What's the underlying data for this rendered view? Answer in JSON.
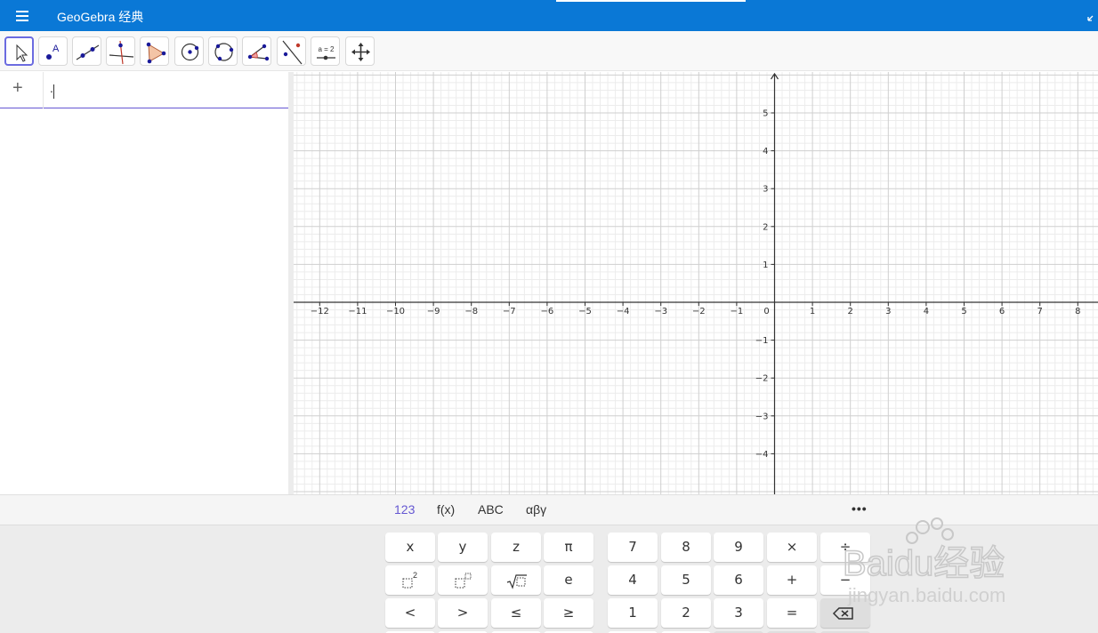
{
  "window": {
    "title": "GeoGebra 经典",
    "accent_color": "#0a78d6",
    "menu_icon": "hamburger-menu-icon",
    "restore_icon": "restore-icon"
  },
  "toolbar": {
    "tools": [
      {
        "name": "move",
        "icon": "arrow-cursor-icon",
        "selected": true
      },
      {
        "name": "point",
        "icon": "point-icon"
      },
      {
        "name": "line",
        "icon": "line-icon"
      },
      {
        "name": "perpendicular-line",
        "icon": "perpendicular-line-icon"
      },
      {
        "name": "polygon",
        "icon": "polygon-icon"
      },
      {
        "name": "circle-center-point",
        "icon": "circle-center-icon"
      },
      {
        "name": "circle-three-points",
        "icon": "circle-three-points-icon"
      },
      {
        "name": "angle",
        "icon": "angle-icon"
      },
      {
        "name": "reflect",
        "icon": "reflect-icon"
      },
      {
        "name": "slider",
        "icon": "slider-icon",
        "label": "a = 2"
      },
      {
        "name": "move-graphics-view",
        "icon": "move-view-icon"
      }
    ]
  },
  "algebra": {
    "add_label": "+",
    "input_value": ".",
    "input_placeholder": ""
  },
  "graphics": {
    "x_range": [
      -12,
      8
    ],
    "y_range": [
      -4,
      5
    ],
    "x_ticks": [
      "−12",
      "−11",
      "−10",
      "−9",
      "−8",
      "−7",
      "−6",
      "−5",
      "−4",
      "−3",
      "−2",
      "−1",
      "0",
      "1",
      "2",
      "3",
      "4",
      "5",
      "6",
      "7",
      "8"
    ],
    "y_ticks": [
      "5",
      "4",
      "3",
      "2",
      "1",
      "−1",
      "−2",
      "−3",
      "−4"
    ],
    "grid": true,
    "axis_color": "#333333",
    "grid_major_color": "#cfcfcf",
    "grid_minor_color": "#ececec"
  },
  "keyboard": {
    "tabs": [
      {
        "label": "123",
        "active": true
      },
      {
        "label": "f(x)"
      },
      {
        "label": "ABC"
      },
      {
        "label": "αβγ"
      }
    ],
    "more_label": "•••",
    "rows": [
      [
        "x",
        "y",
        "z",
        "π"
      ],
      [
        "▫²",
        "▫^",
        "√▫",
        "e"
      ],
      [
        "<",
        ">",
        "≤",
        "≥"
      ]
    ],
    "num_rows": [
      [
        "7",
        "8",
        "9",
        "×",
        "÷"
      ],
      [
        "4",
        "5",
        "6",
        "+",
        "−"
      ],
      [
        "1",
        "2",
        "3",
        "=",
        "⌫"
      ]
    ]
  },
  "watermark": {
    "brand": "Baidu经验",
    "url": "jingyan.baidu.com"
  }
}
